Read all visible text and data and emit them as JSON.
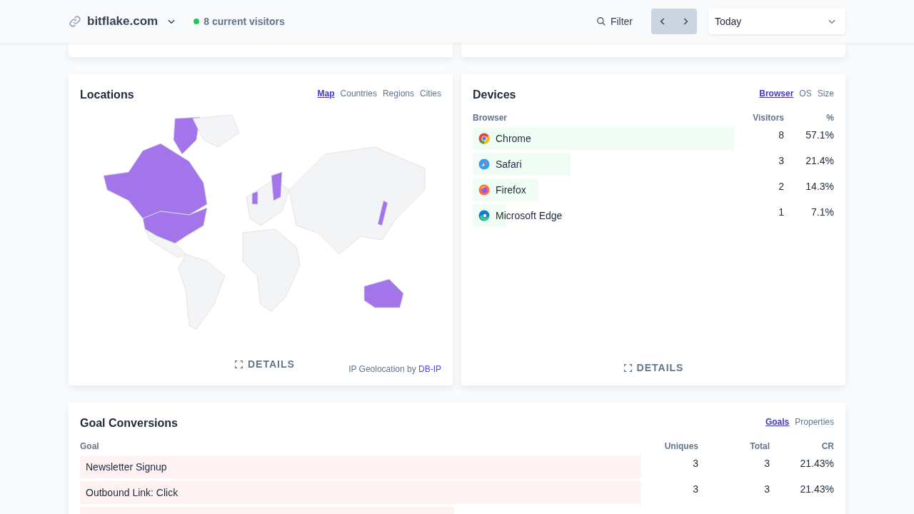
{
  "header": {
    "site": "bitflake.com",
    "visitors": "8 current visitors",
    "filter": "Filter",
    "period": "Today"
  },
  "locations": {
    "title": "Locations",
    "tabs": [
      {
        "label": "Map",
        "selected": true
      },
      {
        "label": "Countries",
        "selected": false
      },
      {
        "label": "Regions",
        "selected": false
      },
      {
        "label": "Cities",
        "selected": false
      }
    ],
    "details": "DETAILS",
    "credit": "IP Geolocation by",
    "credit_link": "DB-IP"
  },
  "devices": {
    "title": "Devices",
    "tabs": [
      {
        "label": "Browser",
        "selected": true
      },
      {
        "label": "OS",
        "selected": false
      },
      {
        "label": "Size",
        "selected": false
      }
    ],
    "columns": [
      "Browser",
      "Visitors",
      "%"
    ],
    "rows": [
      {
        "kind": "chrome",
        "name": "Chrome",
        "visitors": "8",
        "percent": "57.1%",
        "level": 1
      },
      {
        "kind": "safari",
        "name": "Safari",
        "visitors": "3",
        "percent": "21.4%",
        "level": 0.375
      },
      {
        "kind": "firefox",
        "name": "Firefox",
        "visitors": "2",
        "percent": "14.3%",
        "level": 0.25
      },
      {
        "kind": "edge",
        "name": "Microsoft Edge",
        "visitors": "1",
        "percent": "7.1%",
        "level": 0.125
      }
    ],
    "details": "DETAILS"
  },
  "goals": {
    "title": "Goal Conversions",
    "tabs": [
      {
        "label": "Goals",
        "selected": true
      },
      {
        "label": "Properties",
        "selected": false
      }
    ],
    "columns": [
      "Goal",
      "Uniques",
      "Total",
      "CR"
    ],
    "rows": [
      {
        "name": "Newsletter Signup",
        "uniques": "3",
        "total": "3",
        "cr": "21.43%",
        "level": 1
      },
      {
        "name": "Outbound Link: Click",
        "uniques": "3",
        "total": "3",
        "cr": "21.43%",
        "level": 1
      },
      {
        "level": 0.667
      }
    ]
  }
}
